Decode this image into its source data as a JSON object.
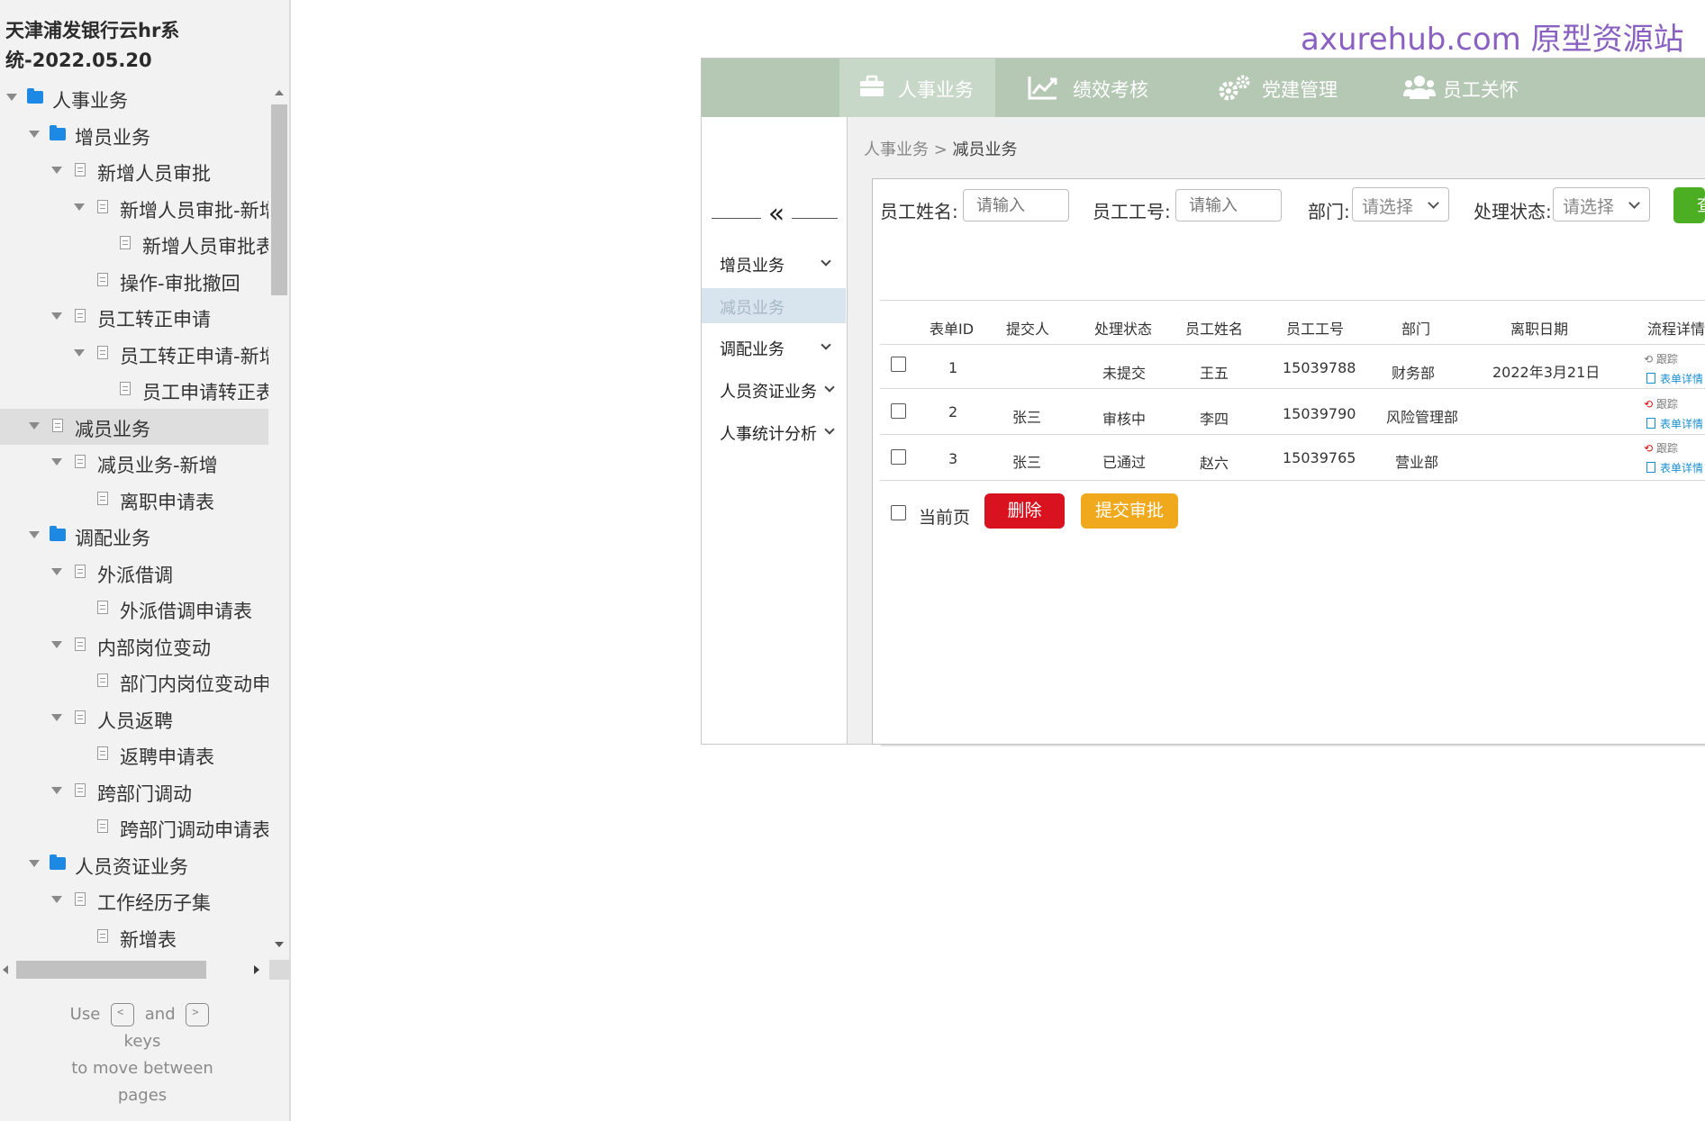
{
  "project": {
    "title_line1": "天津浦发银行云hr系",
    "title_line2": "统-2022.05.20"
  },
  "tree": [
    {
      "label": "人事业务",
      "type": "folder",
      "level": 0,
      "expanded": true
    },
    {
      "label": "增员业务",
      "type": "folder",
      "level": 1,
      "expanded": true
    },
    {
      "label": "新增人员审批",
      "type": "page",
      "level": 2,
      "expanded": true
    },
    {
      "label": "新增人员审批-新增",
      "type": "page",
      "level": 3,
      "expanded": true
    },
    {
      "label": "新增人员审批表",
      "type": "page",
      "level": 4,
      "expanded": false
    },
    {
      "label": "操作-审批撤回",
      "type": "page",
      "level": 3,
      "expanded": false
    },
    {
      "label": "员工转正申请",
      "type": "page",
      "level": 2,
      "expanded": true
    },
    {
      "label": "员工转正申请-新增",
      "type": "page",
      "level": 3,
      "expanded": true
    },
    {
      "label": "员工申请转正表",
      "type": "page",
      "level": 4,
      "expanded": false
    },
    {
      "label": "减员业务",
      "type": "page",
      "level": 1,
      "expanded": true,
      "selected": true
    },
    {
      "label": "减员业务-新增",
      "type": "page",
      "level": 2,
      "expanded": true
    },
    {
      "label": "离职申请表",
      "type": "page",
      "level": 3,
      "expanded": false
    },
    {
      "label": "调配业务",
      "type": "folder",
      "level": 1,
      "expanded": true
    },
    {
      "label": "外派借调",
      "type": "page",
      "level": 2,
      "expanded": true
    },
    {
      "label": "外派借调申请表",
      "type": "page",
      "level": 3,
      "expanded": false
    },
    {
      "label": "内部岗位变动",
      "type": "page",
      "level": 2,
      "expanded": true
    },
    {
      "label": "部门内岗位变动申请表",
      "type": "page",
      "level": 3,
      "expanded": false
    },
    {
      "label": "人员返聘",
      "type": "page",
      "level": 2,
      "expanded": true
    },
    {
      "label": "返聘申请表",
      "type": "page",
      "level": 3,
      "expanded": false
    },
    {
      "label": "跨部门调动",
      "type": "page",
      "level": 2,
      "expanded": true
    },
    {
      "label": "跨部门调动申请表",
      "type": "page",
      "level": 3,
      "expanded": false
    },
    {
      "label": "人员资证业务",
      "type": "folder",
      "level": 1,
      "expanded": true
    },
    {
      "label": "工作经历子集",
      "type": "page",
      "level": 2,
      "expanded": true
    },
    {
      "label": "新增表",
      "type": "page",
      "level": 3,
      "expanded": false
    }
  ],
  "keys_hint": {
    "use": "Use",
    "and": "and",
    "keys": "keys",
    "line2": "to move between",
    "line3": "pages",
    "prev_key": "<",
    "next_key": ">"
  },
  "watermark": "axurehub.com 原型资源站",
  "topnav": [
    {
      "label": "人事业务",
      "icon": "briefcase-icon",
      "active": true
    },
    {
      "label": "绩效考核",
      "icon": "chart-line-icon",
      "active": false
    },
    {
      "label": "党建管理",
      "icon": "gears-icon",
      "active": false
    },
    {
      "label": "员工关怀",
      "icon": "users-icon",
      "active": false
    }
  ],
  "sidemenu": {
    "collapse_symbol": "«",
    "items": [
      {
        "label": "增员业务",
        "has_chevron": true,
        "active": false
      },
      {
        "label": "减员业务",
        "has_chevron": false,
        "active": true
      },
      {
        "label": "调配业务",
        "has_chevron": true,
        "active": false
      },
      {
        "label": "人员资证业务",
        "has_chevron": true,
        "active": false
      },
      {
        "label": "人事统计分析",
        "has_chevron": true,
        "active": false
      }
    ]
  },
  "breadcrumb": {
    "parent": "人事业务",
    "separator": " > ",
    "current": "减员业务"
  },
  "filters": {
    "name_label": "员工姓名:",
    "name_placeholder": "请输入",
    "id_label": "员工工号:",
    "id_placeholder": "请输入",
    "dept_label": "部门:",
    "dept_value": "请选择",
    "status_label": "处理状态:",
    "status_value": "请选择",
    "query_label": "查"
  },
  "table": {
    "headers": [
      "表单ID",
      "提交人",
      "处理状态",
      "员工姓名",
      "员工工号",
      "部门",
      "离职日期",
      "流程详情"
    ],
    "rows": [
      {
        "id": "1",
        "submitter": "",
        "status": "未提交",
        "name": "王五",
        "emp_no": "15039788",
        "dept": "财务部",
        "date": "2022年3月21日",
        "track": "跟踪",
        "form": "表单详情",
        "track_red": false
      },
      {
        "id": "2",
        "submitter": "张三",
        "status": "审核中",
        "name": "李四",
        "emp_no": "15039790",
        "dept": "风险管理部",
        "date": "",
        "track": "跟踪",
        "form": "表单详情",
        "track_red": true
      },
      {
        "id": "3",
        "submitter": "张三",
        "status": "已通过",
        "name": "赵六",
        "emp_no": "15039765",
        "dept": "营业部",
        "date": "",
        "track": "跟踪",
        "form": "表单详情",
        "track_red": true
      }
    ]
  },
  "footer_actions": {
    "select_page_label": "当前页",
    "delete_label": "删除",
    "submit_label": "提交审批"
  },
  "colors": {
    "nav_bg": "#b4c8b4",
    "delete": "#d8121e",
    "submit": "#f0a91c",
    "query": "#4caf23",
    "folder": "#1e88e5"
  }
}
